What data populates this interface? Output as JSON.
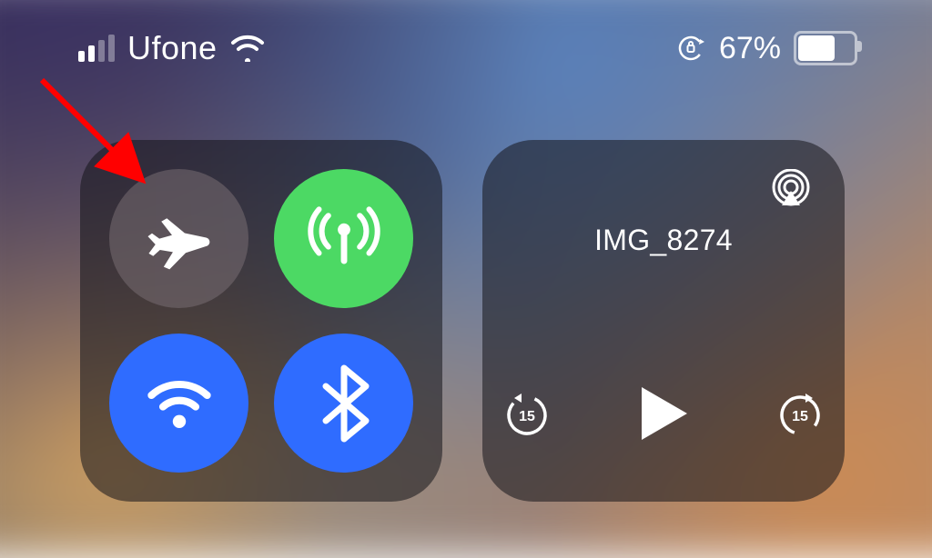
{
  "status_bar": {
    "signal_active_bars": 2,
    "signal_total_bars": 4,
    "carrier": "Ufone",
    "wifi_on": true,
    "rotation_locked": true,
    "battery_percent_text": "67%",
    "battery_percent_value": 67
  },
  "connectivity_panel": {
    "airplane_mode": {
      "on": false,
      "icon": "airplane-icon"
    },
    "cellular_data": {
      "on": true,
      "icon": "antenna-icon"
    },
    "wifi": {
      "on": true,
      "icon": "wifi-icon"
    },
    "bluetooth": {
      "on": true,
      "icon": "bluetooth-icon"
    }
  },
  "media_panel": {
    "title": "IMG_8274",
    "rewind_seconds": "15",
    "forward_seconds": "15",
    "playing": false,
    "airplay_icon": "airplay-icon"
  },
  "annotation": {
    "arrow_target": "airplane-mode-toggle"
  },
  "colors": {
    "toggle_active_green": "#4cd964",
    "toggle_active_blue": "#2f6cff",
    "annotation_arrow": "#ff0000"
  }
}
